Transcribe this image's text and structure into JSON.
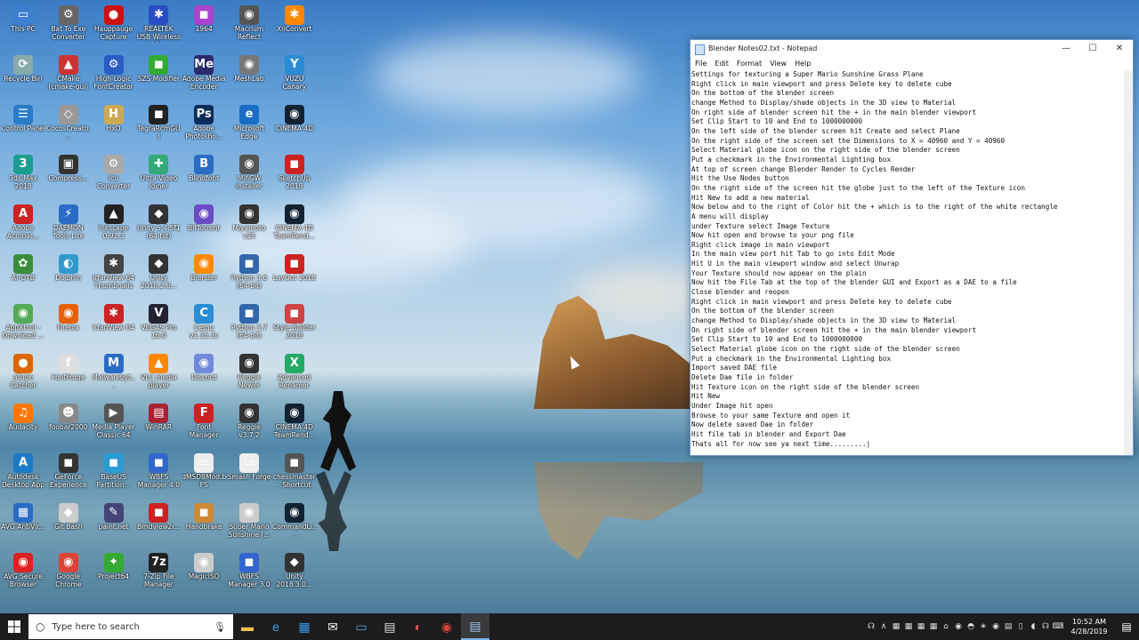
{
  "desktop_icons": [
    {
      "label": "This PC",
      "col": 0,
      "row": 0,
      "color": "#3d7fd1",
      "glyph": "▭"
    },
    {
      "label": "Recycle Bin",
      "col": 0,
      "row": 1,
      "color": "#8aa",
      "glyph": "⟳"
    },
    {
      "label": "Control Panel",
      "col": 0,
      "row": 2,
      "color": "#2a7cc9",
      "glyph": "☰"
    },
    {
      "label": "3ds Max 2018",
      "col": 0,
      "row": 3,
      "color": "#1a9e8f",
      "glyph": "3"
    },
    {
      "label": "Adobe Acrobat...",
      "col": 0,
      "row": 4,
      "color": "#c22",
      "glyph": "A"
    },
    {
      "label": "AI-OTB",
      "col": 0,
      "row": 5,
      "color": "#3a8d3a",
      "glyph": "✿"
    },
    {
      "label": "AppXtool - Download ...",
      "col": 0,
      "row": 6,
      "color": "#5a5",
      "glyph": "◉"
    },
    {
      "label": "aTube Catcher",
      "col": 0,
      "row": 7,
      "color": "#d60",
      "glyph": "●"
    },
    {
      "label": "Audacity",
      "col": 0,
      "row": 8,
      "color": "#f70",
      "glyph": "♫"
    },
    {
      "label": "Autodesk Desktop App",
      "col": 0,
      "row": 9,
      "color": "#1a7bc8",
      "glyph": "A"
    },
    {
      "label": "AVG AntiVir...",
      "col": 0,
      "row": 10,
      "color": "#2a6cc4",
      "glyph": "▦"
    },
    {
      "label": "AVG Secure Browser",
      "col": 0,
      "row": 11,
      "color": "#d22",
      "glyph": "◉"
    },
    {
      "label": "Bat To Exe Converter",
      "col": 1,
      "row": 0,
      "color": "#666",
      "glyph": "⚙"
    },
    {
      "label": "CMake (cmake-gui)",
      "col": 1,
      "row": 1,
      "color": "#c33",
      "glyph": "▲"
    },
    {
      "label": "CocosCreato...",
      "col": 1,
      "row": 2,
      "color": "#999",
      "glyph": "◇"
    },
    {
      "label": "Compress...",
      "col": 1,
      "row": 3,
      "color": "#333",
      "glyph": "▣"
    },
    {
      "label": "DAEMON Tools Lite",
      "col": 1,
      "row": 4,
      "color": "#2a6cc4",
      "glyph": "⚡"
    },
    {
      "label": "Dolphin",
      "col": 1,
      "row": 5,
      "color": "#39c",
      "glyph": "◐"
    },
    {
      "label": "Firefox",
      "col": 1,
      "row": 6,
      "color": "#e66000",
      "glyph": "◉"
    },
    {
      "label": "FontForge",
      "col": 1,
      "row": 7,
      "color": "#ddd",
      "glyph": "f"
    },
    {
      "label": "foobar2000",
      "col": 1,
      "row": 8,
      "color": "#888",
      "glyph": "☻"
    },
    {
      "label": "GeForce Experience",
      "col": 1,
      "row": 9,
      "color": "#333",
      "glyph": "◼"
    },
    {
      "label": "Git Bash",
      "col": 1,
      "row": 10,
      "color": "#ccc",
      "glyph": "◆"
    },
    {
      "label": "Google Chrome",
      "col": 1,
      "row": 11,
      "color": "#db4437",
      "glyph": "◉"
    },
    {
      "label": "Hauppauge Capture",
      "col": 2,
      "row": 0,
      "color": "#c11",
      "glyph": "●"
    },
    {
      "label": "High-Logic FontCreator",
      "col": 2,
      "row": 1,
      "color": "#2a5cc4",
      "glyph": "⚙"
    },
    {
      "label": "HxD",
      "col": 2,
      "row": 2,
      "color": "#ca5",
      "glyph": "H"
    },
    {
      "label": "Ico Converter",
      "col": 2,
      "row": 3,
      "color": "#aaa",
      "glyph": "⚙"
    },
    {
      "label": "Inkscape 0.92.3",
      "col": 2,
      "row": 4,
      "color": "#222",
      "glyph": "▲"
    },
    {
      "label": "IrfanView 64 Thumbnails",
      "col": 2,
      "row": 5,
      "color": "#444",
      "glyph": "✱"
    },
    {
      "label": "IrfanView 64",
      "col": 2,
      "row": 6,
      "color": "#c22",
      "glyph": "✱"
    },
    {
      "label": "Malwarebyt...",
      "col": 2,
      "row": 7,
      "color": "#2a6cc4",
      "glyph": "M"
    },
    {
      "label": "Media Player Classic 64",
      "col": 2,
      "row": 8,
      "color": "#555",
      "glyph": "▶"
    },
    {
      "label": "BaseUS Partition...",
      "col": 2,
      "row": 9,
      "color": "#2a9cd4",
      "glyph": "◼"
    },
    {
      "label": "paint.net",
      "col": 2,
      "row": 10,
      "color": "#447",
      "glyph": "✎"
    },
    {
      "label": "Project64",
      "col": 2,
      "row": 11,
      "color": "#3a3",
      "glyph": "✦"
    },
    {
      "label": "REALTEK USB Wireless LA...",
      "col": 3,
      "row": 0,
      "color": "#2a4cc4",
      "glyph": "✱"
    },
    {
      "label": "SZS Modifier",
      "col": 3,
      "row": 1,
      "color": "#3a3",
      "glyph": "◼"
    },
    {
      "label": "TegraRcmGUI",
      "col": 3,
      "row": 2,
      "color": "#222",
      "glyph": "◼"
    },
    {
      "label": "Ultra Video Joiner",
      "col": 3,
      "row": 3,
      "color": "#3a7",
      "glyph": "✚"
    },
    {
      "label": "Unity 5.4.5f1 (64-bit)",
      "col": 3,
      "row": 4,
      "color": "#333",
      "glyph": "◆"
    },
    {
      "label": "Unity 2018.2.6...",
      "col": 3,
      "row": 5,
      "color": "#333",
      "glyph": "◆"
    },
    {
      "label": "VEGAS Pro 16.0",
      "col": 3,
      "row": 6,
      "color": "#223",
      "glyph": "V"
    },
    {
      "label": "VLC media player",
      "col": 3,
      "row": 7,
      "color": "#f80",
      "glyph": "▲"
    },
    {
      "label": "WinRAR",
      "col": 3,
      "row": 8,
      "color": "#a23",
      "glyph": "▤"
    },
    {
      "label": "WBFS Manager 4.0",
      "col": 3,
      "row": 9,
      "color": "#36c",
      "glyph": "◼"
    },
    {
      "label": "Bmdview2i...",
      "col": 3,
      "row": 10,
      "color": "#c22",
      "glyph": "◼"
    },
    {
      "label": "7-Zip File Manager",
      "col": 3,
      "row": 11,
      "color": "#222",
      "glyph": "7z"
    },
    {
      "label": "1964",
      "col": 4,
      "row": 0,
      "color": "#a4c",
      "glyph": "◼"
    },
    {
      "label": "Adobe Media Encoder",
      "col": 4,
      "row": 1,
      "color": "#2b2b6b",
      "glyph": "Me"
    },
    {
      "label": "Adobe Photosho...",
      "col": 4,
      "row": 2,
      "color": "#0a2b5b",
      "glyph": "Ps"
    },
    {
      "label": "Blindfont",
      "col": 4,
      "row": 3,
      "color": "#2a6cc4",
      "glyph": "B"
    },
    {
      "label": "BitTorrent",
      "col": 4,
      "row": 4,
      "color": "#6a4cc4",
      "glyph": "◉"
    },
    {
      "label": "Blender",
      "col": 4,
      "row": 5,
      "color": "#f80",
      "glyph": "◉"
    },
    {
      "label": "Cemu v1.15.3c",
      "col": 4,
      "row": 6,
      "color": "#2a8cd4",
      "glyph": "C"
    },
    {
      "label": "Discord",
      "col": 4,
      "row": 7,
      "color": "#7289da",
      "glyph": "◉"
    },
    {
      "label": "Font Manager",
      "col": 4,
      "row": 8,
      "color": "#c22",
      "glyph": "F"
    },
    {
      "label": "dMSDBMod.bFS",
      "col": 4,
      "row": 9,
      "color": "#eee",
      "glyph": "▭"
    },
    {
      "label": "Handbrake",
      "col": 4,
      "row": 10,
      "color": "#c83",
      "glyph": "◼"
    },
    {
      "label": "MagicISO",
      "col": 4,
      "row": 11,
      "color": "#ccc",
      "glyph": "◉"
    },
    {
      "label": "Macrium Reflect",
      "col": 5,
      "row": 0,
      "color": "#555",
      "glyph": "◉"
    },
    {
      "label": "MeshLab",
      "col": 5,
      "row": 1,
      "color": "#777",
      "glyph": "◉"
    },
    {
      "label": "Microsoft Edge",
      "col": 5,
      "row": 2,
      "color": "#1a6cc4",
      "glyph": "e"
    },
    {
      "label": "MinGW Installer",
      "col": 5,
      "row": 3,
      "color": "#555",
      "glyph": "◉"
    },
    {
      "label": "Miyamoto v25",
      "col": 5,
      "row": 4,
      "color": "#333",
      "glyph": "◉"
    },
    {
      "label": "Python 3.6 (64-bit)",
      "col": 5,
      "row": 5,
      "color": "#36a",
      "glyph": "◼"
    },
    {
      "label": "Python 3.7 (64-bit)",
      "col": 5,
      "row": 6,
      "color": "#36a",
      "glyph": "◼"
    },
    {
      "label": "Reggie Newer",
      "col": 5,
      "row": 7,
      "color": "#333",
      "glyph": "◉"
    },
    {
      "label": "Reggie v3.7.2",
      "col": 5,
      "row": 8,
      "color": "#333",
      "glyph": "◉"
    },
    {
      "label": "Smash Forge",
      "col": 5,
      "row": 9,
      "color": "#eee",
      "glyph": "▭"
    },
    {
      "label": "Super Mario Sunshine (...",
      "col": 5,
      "row": 10,
      "color": "#ccc",
      "glyph": "◉"
    },
    {
      "label": "WBFS Manager 3.0",
      "col": 5,
      "row": 11,
      "color": "#36c",
      "glyph": "◼"
    },
    {
      "label": "XnConvert",
      "col": 6,
      "row": 0,
      "color": "#f80",
      "glyph": "✱"
    },
    {
      "label": "VUZU Canary",
      "col": 6,
      "row": 1,
      "color": "#2a8cd4",
      "glyph": "Y"
    },
    {
      "label": "CINEMA 4D",
      "col": 6,
      "row": 2,
      "color": "#123",
      "glyph": "◉"
    },
    {
      "label": "SketchUp 2018",
      "col": 6,
      "row": 3,
      "color": "#c22",
      "glyph": "◼"
    },
    {
      "label": "CINEMA 4D TeamRend...",
      "col": 6,
      "row": 4,
      "color": "#123",
      "glyph": "◉"
    },
    {
      "label": "LayOut 2018",
      "col": 6,
      "row": 5,
      "color": "#c22",
      "glyph": "◼"
    },
    {
      "label": "Style Builder 2018",
      "col": 6,
      "row": 6,
      "color": "#c44",
      "glyph": "◼"
    },
    {
      "label": "Advanced Renamer",
      "col": 6,
      "row": 7,
      "color": "#2a6",
      "glyph": "X"
    },
    {
      "label": "CINEMA 4D TeamRend...",
      "col": 6,
      "row": 8,
      "color": "#123",
      "glyph": "◉"
    },
    {
      "label": "chessmaster - Shortcut",
      "col": 6,
      "row": 9,
      "color": "#555",
      "glyph": "◼"
    },
    {
      "label": "CommandLi...",
      "col": 6,
      "row": 10,
      "color": "#123",
      "glyph": "◉"
    },
    {
      "label": "Unity 2018.3.0...",
      "col": 6,
      "row": 11,
      "color": "#333",
      "glyph": "◆"
    }
  ],
  "notepad": {
    "title": "Blender Notes02.txt - Notepad",
    "menu": [
      "File",
      "Edit",
      "Format",
      "View",
      "Help"
    ],
    "controls": {
      "minimize": "—",
      "maximize": "☐",
      "close": "✕"
    },
    "lines": [
      "Settings for texturing a Super Mario Sunshine Grass Plane",
      "Right click in main viewport and press Delete key to delete cube",
      "On the bottom of the blender screen",
      "change Method to Display/shade objects in the 3D view to Material",
      "On right side of blender screen hit the + in the main blender viewport",
      "Set Clip Start to 10 and End to 1000000000",
      "On the left side of the blender screen hit Create and select Plane",
      "On the right side of the screen set the Dimensions to X = 40960 and Y = 40960",
      "Select Material globe icon on the right side of the blender screen",
      "Put a checkmark in the Environmental Lighting box",
      "At top of screen change Blender Render to Cycles Render",
      "Hit the Use Nodes button",
      "On the right side of the screen hit the globe just to the left of the Texture icon",
      "Hit New to add a new material",
      "Now below and to the right of Color hit the + which is to the right of the white rectangle",
      "A menu will display",
      "under Texture select Image Texture",
      "Now hit open and browse to your png file",
      "Right click image in main viewport",
      "In the main view port hit Tab to go into Edit Mode",
      "Hit U in the main viewport window and select Unwrap",
      "Your Texture should now appear on the plain",
      "Now hit the File Tab at the top of the blender GUI and Export as a DAE to a file",
      "Close blender and reopen",
      "Right click in main viewport and press Delete key to delete cube",
      "On the bottom of the blender screen",
      "change Method to Display/shade objects in the 3D view to Material",
      "On right side of blender screen hit the + in the main blender viewport",
      "Set Clip Start to 10 and End to 1000000000",
      "Select Material globe icon on the right side of the blender screen",
      "Put a checkmark in the Environmental Lighting box",
      "Import saved DAE file",
      "Delete Dae file in folder",
      "Hit Texture icon on the right side of the blender screen",
      "Hit New",
      "Under Image hit open",
      "Browse to your same Texture and open it",
      "Now delete saved Dae in folder",
      "Hit file tab in blender and Export Dae",
      "Thats all for now see ya next time.........|"
    ]
  },
  "taskbar": {
    "search_placeholder": "Type here to search",
    "apps": [
      {
        "name": "file-explorer",
        "glyph": "▬",
        "color": "#f2c24e"
      },
      {
        "name": "edge",
        "glyph": "e",
        "color": "#3a9be8"
      },
      {
        "name": "store",
        "glyph": "▦",
        "color": "#3a9be8"
      },
      {
        "name": "mail",
        "glyph": "✉",
        "color": "#fff"
      },
      {
        "name": "photos",
        "glyph": "▭",
        "color": "#5aa0e0"
      },
      {
        "name": "calculator",
        "glyph": "▤",
        "color": "#ddd"
      },
      {
        "name": "app-red",
        "glyph": "◐",
        "color": "#e55"
      },
      {
        "name": "chrome",
        "glyph": "◉",
        "color": "#db4437"
      },
      {
        "name": "notepad",
        "glyph": "▤",
        "color": "#9cc8ef"
      }
    ],
    "tray_icons": [
      "☊",
      "∧",
      "▦",
      "▦",
      "▦",
      "▦",
      "⌂",
      "◉",
      "◓",
      "∗",
      "◉",
      "▤",
      "▯",
      "◖",
      "☊",
      "⌨"
    ],
    "time": "10:52 AM",
    "date": "4/28/2019"
  }
}
